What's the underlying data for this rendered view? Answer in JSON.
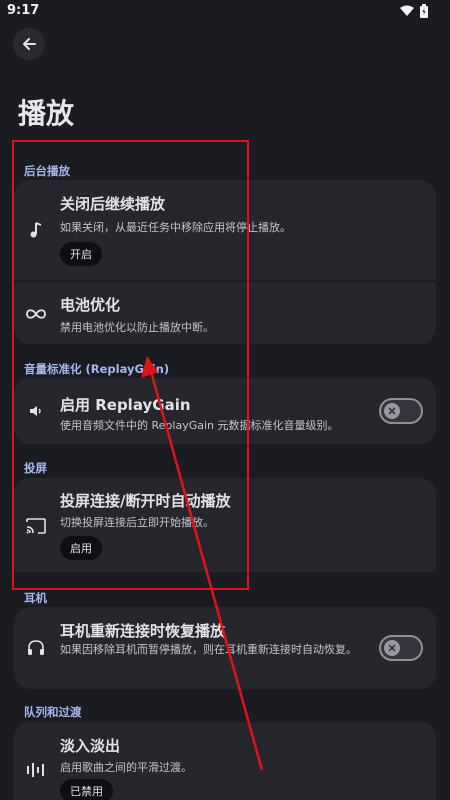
{
  "status": {
    "time": "9:17"
  },
  "page": {
    "title": "播放"
  },
  "sections": {
    "background": "后台播放",
    "replaygain": "音量标准化 (ReplayGain)",
    "cast": "投屏",
    "headset": "耳机",
    "queue": "队列和过渡"
  },
  "items": {
    "continue": {
      "title": "关闭后继续播放",
      "desc": "如果关闭，从最近任务中移除应用将停止播放。",
      "chip": "开启"
    },
    "battery": {
      "title": "电池优化",
      "desc": "禁用电池优化以防止播放中断。"
    },
    "replaygain": {
      "title": "启用 ReplayGain",
      "desc": "使用音频文件中的 ReplayGain 元数据标准化音量级别。",
      "switch_on": false
    },
    "cast": {
      "title": "投屏连接/断开时自动播放",
      "desc": "切换投屏连接后立即开始播放。",
      "chip": "启用"
    },
    "headset": {
      "title": "耳机重新连接时恢复播放",
      "desc": "如果因移除耳机而暂停播放，则在耳机重新连接时自动恢复。",
      "switch_on": false
    },
    "fade": {
      "title": "淡入淡出",
      "desc": "启用歌曲之间的平滑过渡。",
      "chip": "已禁用"
    }
  },
  "colors": {
    "background": "#1b1c21",
    "card": "#26272d",
    "accent": "#a7b8ee",
    "annotation": "#e0121b"
  },
  "icons": {
    "back": "arrow-left-icon",
    "continue": "music-note-icon",
    "battery": "infinity-icon",
    "replaygain": "volume-icon",
    "cast": "cast-icon",
    "headset": "headphones-icon",
    "fade": "equalizer-icon"
  }
}
